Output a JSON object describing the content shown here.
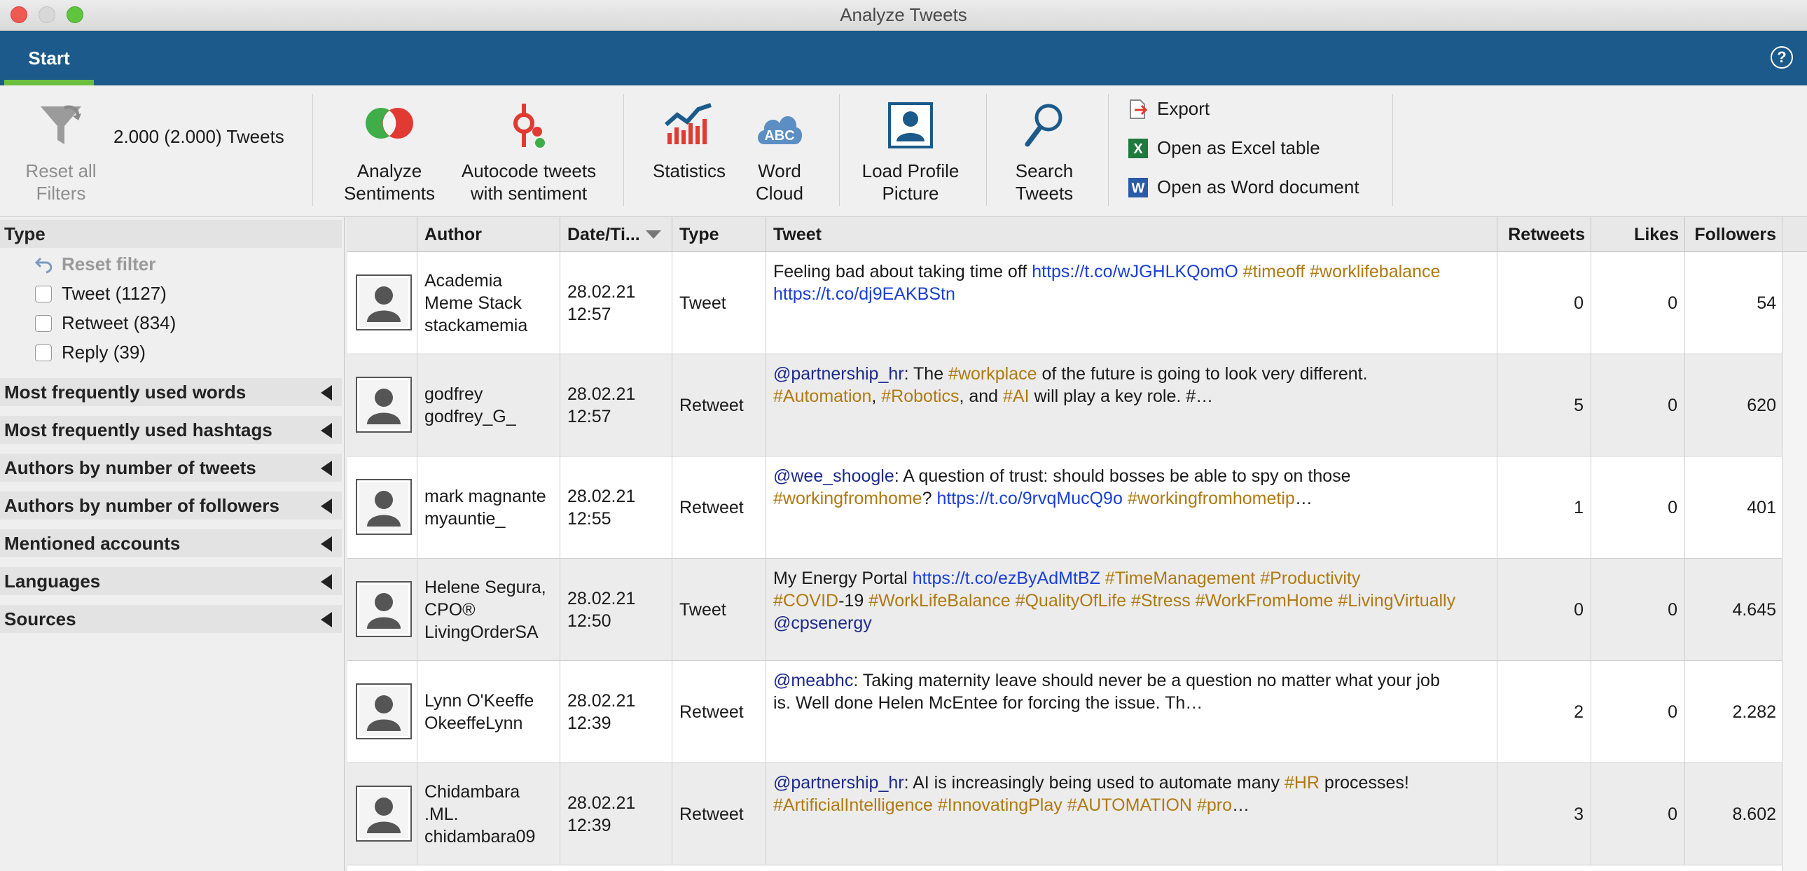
{
  "window": {
    "title": "Analyze Tweets"
  },
  "ribbon": {
    "tab": "Start",
    "help": "?"
  },
  "toolbar": {
    "reset_filters": "Reset all Filters",
    "tweet_count": "2.000 (2.000) Tweets",
    "analyze_sentiments": "Analyze Sentiments",
    "autocode": "Autocode tweets with sentiment",
    "statistics": "Statistics",
    "word_cloud": "Word Cloud",
    "load_profile": "Load Profile Picture",
    "search_tweets": "Search Tweets",
    "export": "Export",
    "open_excel": "Open as Excel table",
    "open_word": "Open as Word document"
  },
  "sidebar": {
    "type_header": "Type",
    "reset_filter": "Reset filter",
    "type_options": [
      "Tweet (1127)",
      "Retweet (834)",
      "Reply (39)"
    ],
    "sections": [
      "Most frequently used words",
      "Most frequently used hashtags",
      "Authors by number of tweets",
      "Authors by number of followers",
      "Mentioned accounts",
      "Languages",
      "Sources"
    ]
  },
  "table": {
    "headers": [
      "Author",
      "Date/Ti...",
      "Type",
      "Tweet",
      "Retweets",
      "Likes",
      "Followers"
    ],
    "rows": [
      {
        "author": [
          "Academia",
          "Meme Stack",
          "stackamemia"
        ],
        "date": [
          "28.02.21",
          "12:57"
        ],
        "type": "Tweet",
        "tweet": [
          [
            {
              "t": "Feeling bad about taking time off ",
              "k": "txt"
            },
            {
              "t": "https://t.co/wJGHLKQomO",
              "k": "link"
            },
            {
              "t": " ",
              "k": "txt"
            },
            {
              "t": "#timeoff",
              "k": "tag"
            },
            {
              "t": " ",
              "k": "txt"
            },
            {
              "t": "#worklifebalance",
              "k": "tag"
            }
          ],
          [
            {
              "t": "https://t.co/dj9EAKBStn",
              "k": "link"
            }
          ]
        ],
        "retweets": "0",
        "likes": "0",
        "followers": "54"
      },
      {
        "author": [
          "godfrey",
          "godfrey_G_"
        ],
        "date": [
          "28.02.21",
          "12:57"
        ],
        "type": "Retweet",
        "tweet": [
          [
            {
              "t": "@partnership_hr",
              "k": "mention"
            },
            {
              "t": ": The ",
              "k": "txt"
            },
            {
              "t": "#workplace",
              "k": "tag"
            },
            {
              "t": " of the future is going to look very different.",
              "k": "txt"
            }
          ],
          [
            {
              "t": "#Automation",
              "k": "tag"
            },
            {
              "t": ", ",
              "k": "txt"
            },
            {
              "t": "#Robotics",
              "k": "tag"
            },
            {
              "t": ", and ",
              "k": "txt"
            },
            {
              "t": "#AI",
              "k": "tag"
            },
            {
              "t": " will play a key role. #…",
              "k": "txt"
            }
          ]
        ],
        "retweets": "5",
        "likes": "0",
        "followers": "620"
      },
      {
        "author": [
          "mark magnante",
          "myauntie_"
        ],
        "date": [
          "28.02.21",
          "12:55"
        ],
        "type": "Retweet",
        "tweet": [
          [
            {
              "t": "@wee_shoogle",
              "k": "mention"
            },
            {
              "t": ": A question of trust: should bosses be able to spy on those",
              "k": "txt"
            }
          ],
          [
            {
              "t": "#workingfromhome",
              "k": "tag"
            },
            {
              "t": "? ",
              "k": "txt"
            },
            {
              "t": "https://t.co/9rvqMucQ9o",
              "k": "link"
            },
            {
              "t": " ",
              "k": "txt"
            },
            {
              "t": "#workingfromhometip",
              "k": "tag"
            },
            {
              "t": "…",
              "k": "txt"
            }
          ]
        ],
        "retweets": "1",
        "likes": "0",
        "followers": "401"
      },
      {
        "author": [
          "Helene Segura,",
          "CPO®",
          "LivingOrderSA"
        ],
        "date": [
          "28.02.21",
          "12:50"
        ],
        "type": "Tweet",
        "tweet": [
          [
            {
              "t": "My Energy Portal ",
              "k": "txt"
            },
            {
              "t": "https://t.co/ezByAdMtBZ",
              "k": "link"
            },
            {
              "t": " ",
              "k": "txt"
            },
            {
              "t": "#TimeManagement",
              "k": "tag"
            },
            {
              "t": " ",
              "k": "txt"
            },
            {
              "t": "#Productivity",
              "k": "tag"
            }
          ],
          [
            {
              "t": "#COVID",
              "k": "tag"
            },
            {
              "t": "-19 ",
              "k": "txt"
            },
            {
              "t": "#WorkLifeBalance",
              "k": "tag"
            },
            {
              "t": " ",
              "k": "txt"
            },
            {
              "t": "#QualityOfLife",
              "k": "tag"
            },
            {
              "t": " ",
              "k": "txt"
            },
            {
              "t": "#Stress",
              "k": "tag"
            },
            {
              "t": " ",
              "k": "txt"
            },
            {
              "t": "#WorkFromHome",
              "k": "tag"
            },
            {
              "t": " ",
              "k": "txt"
            },
            {
              "t": "#LivingVirtually",
              "k": "tag"
            }
          ],
          [
            {
              "t": "@cpsenergy",
              "k": "mention"
            }
          ]
        ],
        "retweets": "0",
        "likes": "0",
        "followers": "4.645"
      },
      {
        "author": [
          "Lynn O'Keeffe",
          "OkeeffeLynn"
        ],
        "date": [
          "28.02.21",
          "12:39"
        ],
        "type": "Retweet",
        "tweet": [
          [
            {
              "t": "@meabhc",
              "k": "mention"
            },
            {
              "t": ": Taking maternity leave should never be a question no matter what your job",
              "k": "txt"
            }
          ],
          [
            {
              "t": "is. Well done Helen McEntee for forcing the issue. Th…",
              "k": "txt"
            }
          ]
        ],
        "retweets": "2",
        "likes": "0",
        "followers": "2.282"
      },
      {
        "author": [
          "Chidambara",
          ".ML.",
          "chidambara09"
        ],
        "date": [
          "28.02.21",
          "12:39"
        ],
        "type": "Retweet",
        "tweet": [
          [
            {
              "t": "@partnership_hr",
              "k": "mention"
            },
            {
              "t": ": AI is increasingly being used to automate many ",
              "k": "txt"
            },
            {
              "t": "#HR",
              "k": "tag"
            },
            {
              "t": " processes!",
              "k": "txt"
            }
          ],
          [
            {
              "t": "#ArtificialIntelligence",
              "k": "tag"
            },
            {
              "t": " ",
              "k": "txt"
            },
            {
              "t": "#InnovatingPlay",
              "k": "tag"
            },
            {
              "t": " ",
              "k": "txt"
            },
            {
              "t": "#AUTOMATION",
              "k": "tag"
            },
            {
              "t": " ",
              "k": "txt"
            },
            {
              "t": "#pro",
              "k": "tag"
            },
            {
              "t": "…",
              "k": "txt"
            }
          ]
        ],
        "retweets": "3",
        "likes": "0",
        "followers": "8.602"
      }
    ]
  },
  "colors": {
    "ribbon": "#1b5a8a",
    "accent_tab": "#6cbf3e",
    "link": "#1a3fd6",
    "hashtag": "#b07a12",
    "mention": "#1c2a8c"
  }
}
